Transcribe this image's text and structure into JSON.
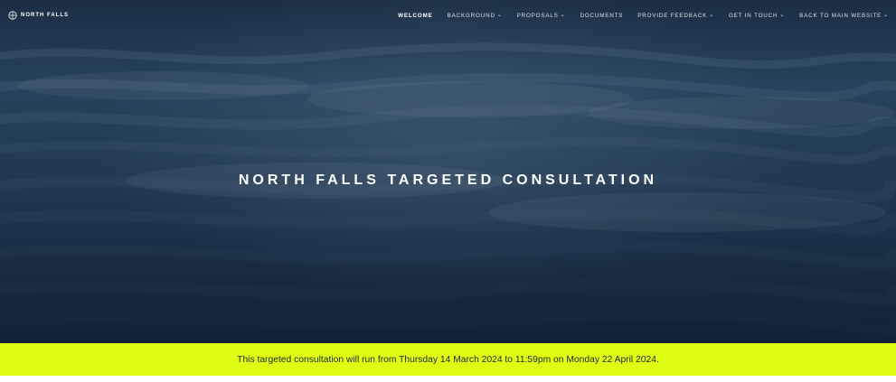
{
  "brand": {
    "name": "NORTH FALLS",
    "icon": "compass-icon"
  },
  "nav": {
    "items": [
      {
        "label": "WELCOME",
        "active": true,
        "dropdown": false
      },
      {
        "label": "BACKGROUND",
        "active": false,
        "dropdown": true
      },
      {
        "label": "PROPOSALS",
        "active": false,
        "dropdown": true
      },
      {
        "label": "DOCUMENTS",
        "active": false,
        "dropdown": false
      },
      {
        "label": "PROVIDE FEEDBACK",
        "active": false,
        "dropdown": true
      },
      {
        "label": "GET IN TOUCH",
        "active": false,
        "dropdown": true
      },
      {
        "label": "BACK TO MAIN WEBSITE",
        "active": false,
        "dropdown": true
      }
    ]
  },
  "hero": {
    "title": "NORTH FALLS TARGETED CONSULTATION"
  },
  "banner": {
    "text": "This targeted consultation will run from Thursday 14 March 2024 to 11:59pm on Monday 22 April 2024."
  },
  "colors": {
    "banner_background": "#e0fe12",
    "hero_dark": "#1b2e43",
    "text_light": "#ffffff"
  }
}
